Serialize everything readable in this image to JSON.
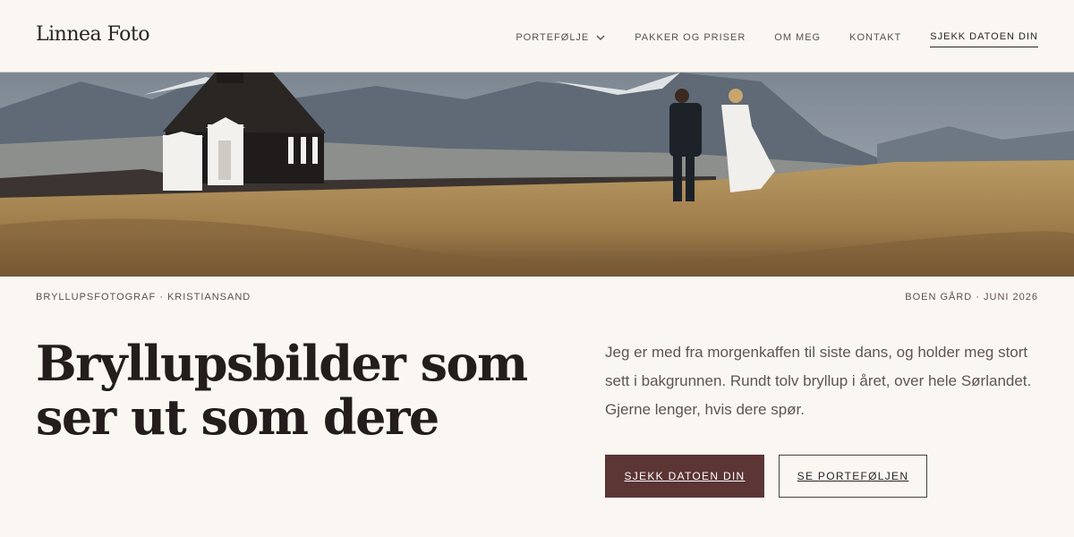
{
  "brand": {
    "logo": "Linnea Foto"
  },
  "nav": {
    "portfolio": "PORTEFØLJE",
    "packages": "PAKKER OG PRISER",
    "about": "OM MEG",
    "contact": "KONTAKT",
    "cta": "SJEKK DATOEN DIN"
  },
  "hero": {
    "image_icon": "wedding-couple-church-landscape"
  },
  "meta": {
    "left": "BRYLLUPSFOTOGRAF · KRISTIANSAND",
    "right": "BOEN GÅRD · JUNI 2026"
  },
  "main": {
    "headline_line1": "Bryllupsbilder som",
    "headline_line2": "ser ut som dere",
    "intro": "Jeg er med fra morgenkaffen til siste dans, og holder meg stort sett i bakgrunnen. Rundt tolv bryllup i året, over hele Sørlandet. Gjerne lenger, hvis dere spør.",
    "primary_button": "SJEKK DATOEN DIN",
    "secondary_button": "SE PORTEFØLJEN"
  },
  "colors": {
    "background": "#faf6f1",
    "text": "#2b2523",
    "accent": "#5c3535"
  }
}
